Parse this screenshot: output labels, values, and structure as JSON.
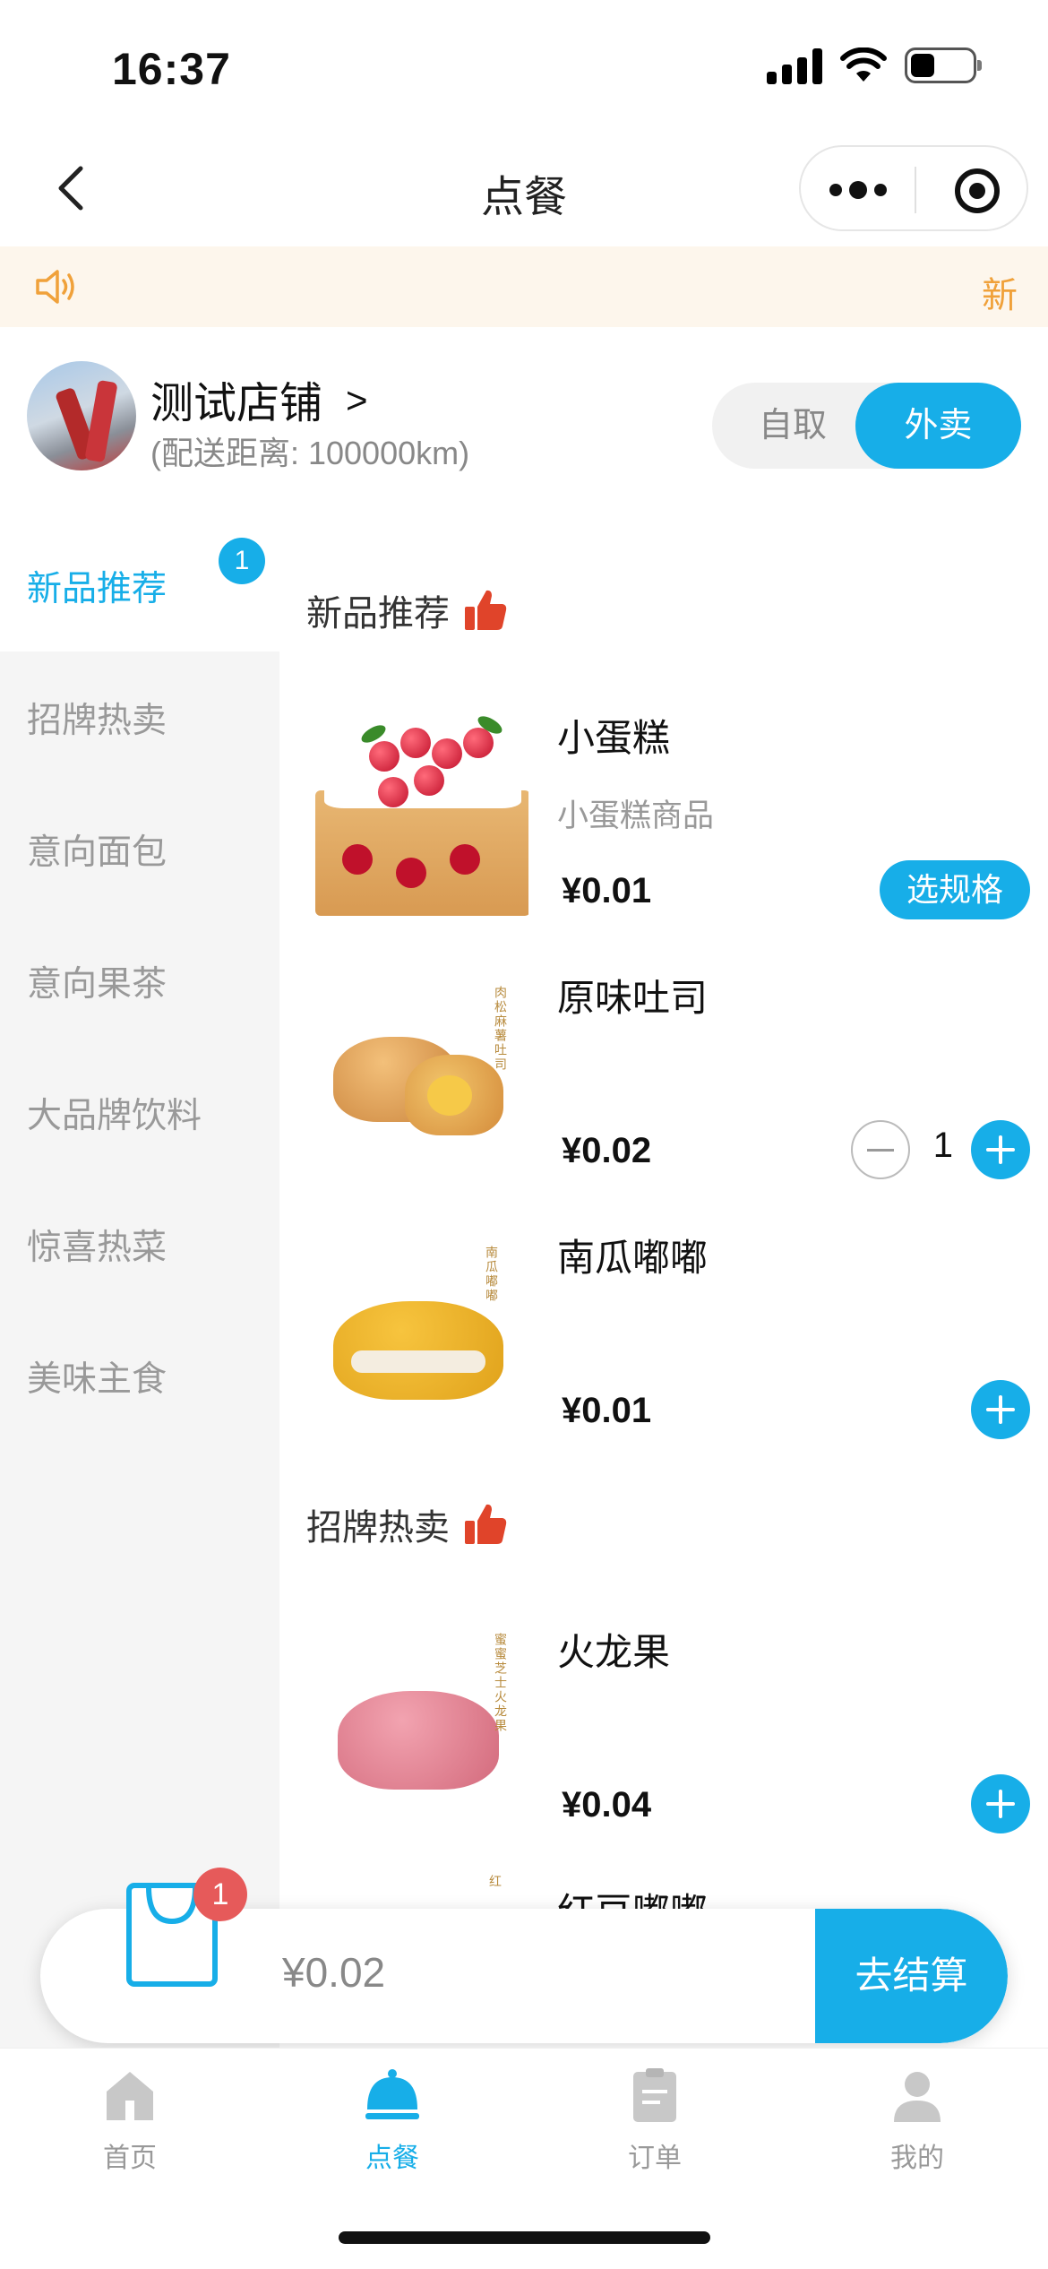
{
  "status": {
    "time": "16:37"
  },
  "nav": {
    "title": "点餐"
  },
  "notice": {
    "text": "新"
  },
  "store": {
    "name": "测试店铺",
    "arrow": ">",
    "distance": "(配送距离: 100000km)",
    "mode_pickup": "自取",
    "mode_delivery": "外卖",
    "selected_mode": "外卖"
  },
  "sidebar": {
    "items": [
      {
        "label": "新品推荐",
        "badge": "1",
        "active": true
      },
      {
        "label": "招牌热卖"
      },
      {
        "label": "意向面包"
      },
      {
        "label": "意向果茶"
      },
      {
        "label": "大品牌饮料"
      },
      {
        "label": "惊喜热菜"
      },
      {
        "label": "美味主食"
      }
    ]
  },
  "sections": [
    {
      "title": "新品推荐",
      "icon": "thumbs-up-icon",
      "products": [
        {
          "name": "小蛋糕",
          "desc": "小蛋糕商品",
          "price": "¥0.01",
          "action": "选规格"
        },
        {
          "name": "原味吐司",
          "price": "¥0.02",
          "qty": "1",
          "image_text": "肉松麻薯吐司"
        },
        {
          "name": "南瓜嘟嘟",
          "price": "¥0.01",
          "image_text": "南瓜嘟嘟"
        }
      ]
    },
    {
      "title": "招牌热卖",
      "icon": "thumbs-up-icon",
      "products": [
        {
          "name": "火龙果",
          "price": "¥0.04",
          "image_text": "蜜蜜芝士火龙果"
        },
        {
          "name": "红豆嘟嘟",
          "image_text": "红"
        }
      ]
    }
  ],
  "cart": {
    "count": "1",
    "total": "¥0.02",
    "checkout": "去结算"
  },
  "tabbar": {
    "items": [
      {
        "label": "首页",
        "icon": "home-icon"
      },
      {
        "label": "点餐",
        "icon": "cloche-icon",
        "active": true
      },
      {
        "label": "订单",
        "icon": "clipboard-icon"
      },
      {
        "label": "我的",
        "icon": "user-icon"
      }
    ]
  },
  "colors": {
    "accent": "#17aee8",
    "notice_bg": "#fdf6ec",
    "notice_fg": "#f0a13a",
    "badge_red": "#e65a5a",
    "thumb_red": "#e0442a"
  }
}
